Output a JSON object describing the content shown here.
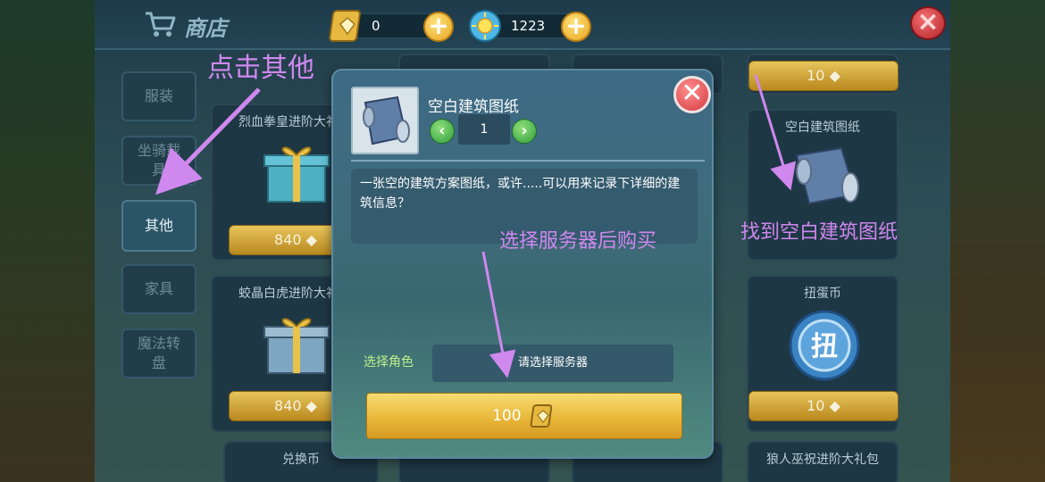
{
  "header": {
    "shop_title": "商店",
    "gem_count": "0",
    "coin_count": "1223",
    "plus_label": "+"
  },
  "sidebar": {
    "items": [
      {
        "label": "服装"
      },
      {
        "label": "坐骑载具"
      },
      {
        "label": "其他"
      },
      {
        "label": "家具"
      },
      {
        "label": "魔法转盘"
      }
    ],
    "active_index": 2
  },
  "cards": [
    {
      "title": "烈血拳皇进阶大礼包",
      "price": "840"
    },
    {
      "title": "蛟晶白虎进阶大礼包",
      "price": "840"
    },
    {
      "title": "兑换币",
      "price": ""
    },
    {
      "title": "",
      "price": "10"
    },
    {
      "title": "空白建筑图纸",
      "price": ""
    },
    {
      "title": "扭蛋币",
      "price": "10"
    },
    {
      "title": "狼人巫祝进阶大礼包",
      "price": ""
    }
  ],
  "modal": {
    "item_name": "空白建筑图纸",
    "quantity": "1",
    "description": "一张空的建筑方案图纸，或许.....可以用来记录下详细的建筑信息？",
    "role_label": "选择角色",
    "server_placeholder": "请选择服务器",
    "buy_price": "100",
    "close_label": "✕"
  },
  "annotations": {
    "click_other": "点击其他",
    "find_blueprint": "找到空白建筑图纸",
    "select_server": "选择服务器后购买"
  },
  "colors": {
    "annotation": "#cf88ee",
    "gold": "#e9b83a",
    "green_arrow": "#2f9c3c",
    "close_red": "#d43a3e"
  }
}
